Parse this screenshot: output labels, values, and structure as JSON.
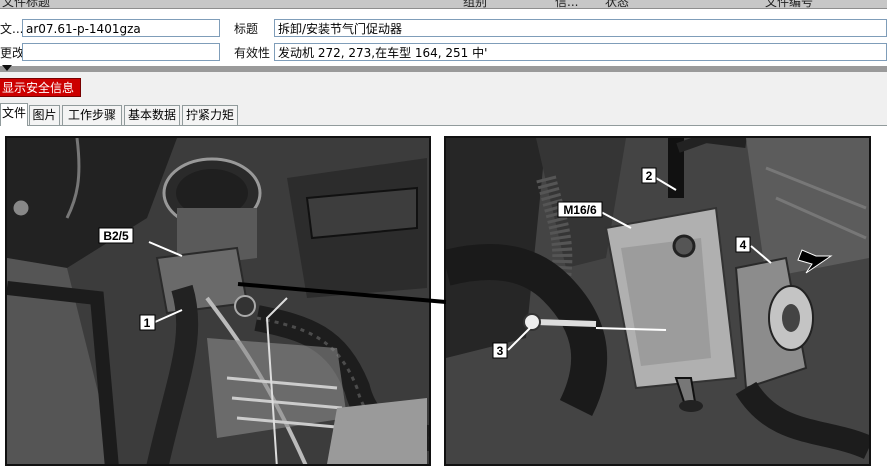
{
  "header": {
    "doc_label": "文...",
    "doc_value": "ar07.61-p-1401gza",
    "title_label": "标题",
    "title_value": "拆卸/安装节气门促动器",
    "change_label": "更改",
    "change_value": "",
    "validity_label": "有效性",
    "validity_value": "发动机 272, 273,在车型 164, 251 中'"
  },
  "safety_button": "显示安全信息",
  "tabs": [
    {
      "label": "文件",
      "active": true
    },
    {
      "label": "图片",
      "active": false
    },
    {
      "label": "工作步骤",
      "active": false
    },
    {
      "label": "基本数据",
      "active": false
    },
    {
      "label": "拧紧力矩",
      "active": false
    }
  ],
  "figure": {
    "left_callouts": [
      "B2/5",
      "1"
    ],
    "right_callouts": [
      "2",
      "M16/6",
      "4",
      "3"
    ]
  }
}
